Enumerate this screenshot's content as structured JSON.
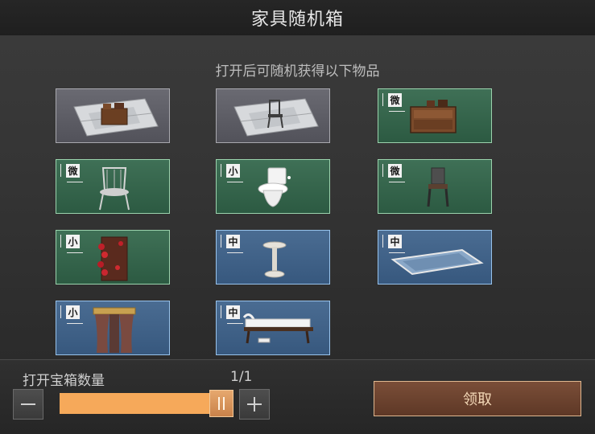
{
  "header": {
    "title": "家具随机箱"
  },
  "content": {
    "subtitle": "打开后可随机获得以下物品"
  },
  "items": [
    {
      "kind": "blueprint",
      "icon": "blueprint-cabinet-icon"
    },
    {
      "kind": "blueprint",
      "icon": "blueprint-chair-icon"
    },
    {
      "kind": "green",
      "size": "微",
      "icon": "wooden-cabinet-icon"
    },
    {
      "kind": "green",
      "size": "微",
      "icon": "wicker-chair-icon"
    },
    {
      "kind": "green",
      "size": "小",
      "icon": "toilet-icon"
    },
    {
      "kind": "green",
      "size": "微",
      "icon": "small-chair-icon"
    },
    {
      "kind": "green",
      "size": "小",
      "icon": "rose-trellis-icon"
    },
    {
      "kind": "blue",
      "size": "中",
      "icon": "fountain-icon"
    },
    {
      "kind": "blue",
      "size": "中",
      "icon": "rug-icon"
    },
    {
      "kind": "blue",
      "size": "小",
      "icon": "curtain-icon"
    },
    {
      "kind": "blue",
      "size": "中",
      "icon": "daybed-icon"
    }
  ],
  "footer": {
    "qty_label": "打开宝箱数量",
    "qty_count": "1/1",
    "slider_fraction": 1.0,
    "claim_label": "领取"
  },
  "colors": {
    "slider": "#f6a95a",
    "claim_border": "#e0b890",
    "green_tile": "#3f7056",
    "blue_tile": "#4a6c92"
  }
}
